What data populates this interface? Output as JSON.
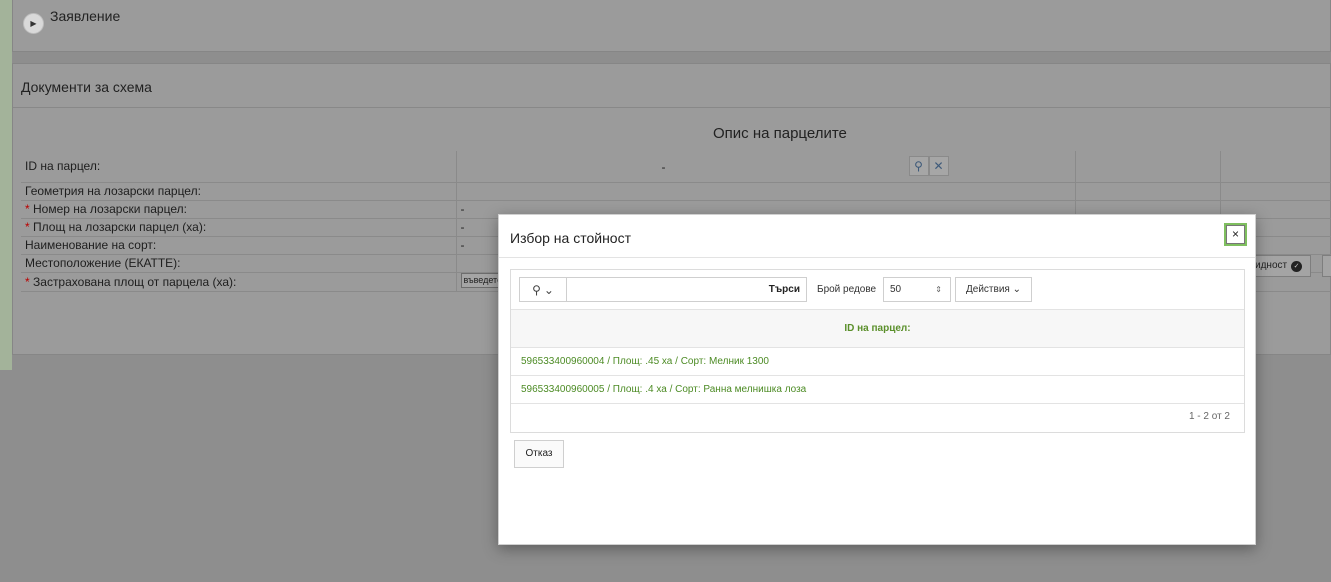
{
  "top_panel": {
    "title": "Заявление"
  },
  "docs_panel": {
    "title": "Документи за схема",
    "section_title": "Опис на парцелите",
    "fields": [
      {
        "label": "ID на парцел:",
        "required": false,
        "value": "-"
      },
      {
        "label": "Геометрия на лозарски парцел:",
        "required": false,
        "value": ""
      },
      {
        "label": "Номер на лозарски парцел:",
        "required": true,
        "value": "-"
      },
      {
        "label": "Площ на лозарски парцел (ха):",
        "required": true,
        "value": "-"
      },
      {
        "label": "Наименование на сорт:",
        "required": false,
        "value": "-"
      },
      {
        "label": "Местоположение (ЕКАТТЕ):",
        "required": false,
        "value": ""
      },
      {
        "label": "Застрахована площ от парцела (ха):",
        "required": true,
        "value": ""
      }
    ],
    "enter_placeholder": "въведете",
    "required_mark": "*",
    "validity_button": "идност"
  },
  "modal": {
    "title": "Избор на стойност",
    "close_label": "×",
    "search_placeholder": "",
    "search_button": "Търси",
    "rows_label": "Брой редове",
    "rows_value": "50",
    "actions_label": "Действия",
    "column_header": "ID на парцел:",
    "rows": [
      "596533400960004 / Площ: .45 ха / Сорт: Мелник 1300",
      "596533400960005 / Площ: .4 ха / Сорт: Ранна мелнишка лоза"
    ],
    "pagination": "1 - 2 от 2",
    "cancel_button": "Отказ"
  },
  "icons": {
    "expand": "expand-icon",
    "search": "search-icon",
    "clear": "clear-icon",
    "check": "check-circle-icon",
    "chevron": "chevron-down-icon",
    "sort": "sort-arrows-icon"
  }
}
